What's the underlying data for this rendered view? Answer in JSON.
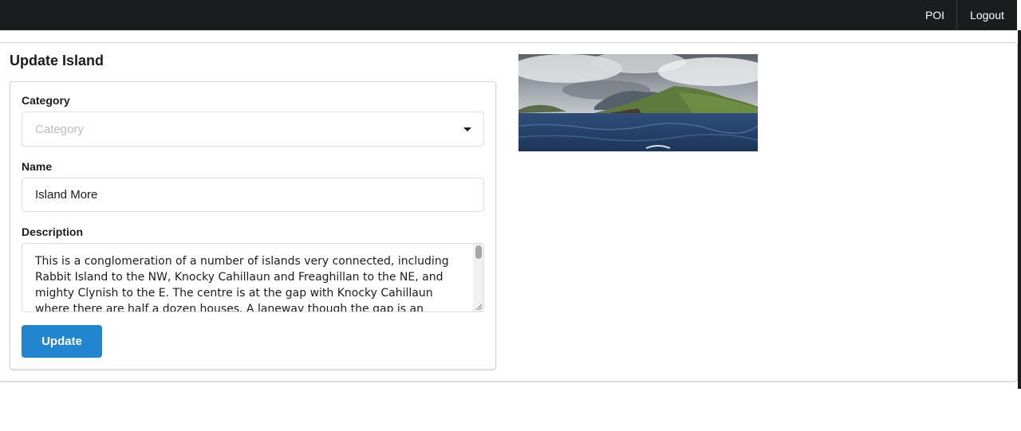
{
  "nav": {
    "poi_label": "POI",
    "logout_label": "Logout"
  },
  "page": {
    "title": "Update Island"
  },
  "form": {
    "category_label": "Category",
    "category_placeholder": "Category",
    "name_label": "Name",
    "name_value": "Island More",
    "description_label": "Description",
    "description_value": "This is a conglomeration of a number of islands very connected, including Rabbit Island to the NW, Knocky Cahillaun and Freaghillan to the NE, and mighty Clynish to the E. The centre is at the gap with Knocky Cahillaun where there are half a dozen houses. A laneway though the gap is an",
    "update_label": "Update"
  },
  "colors": {
    "navbar": "#1b1c1d",
    "primary_button": "#2185d0"
  },
  "icons": {
    "dropdown": "chevron-down-icon"
  }
}
